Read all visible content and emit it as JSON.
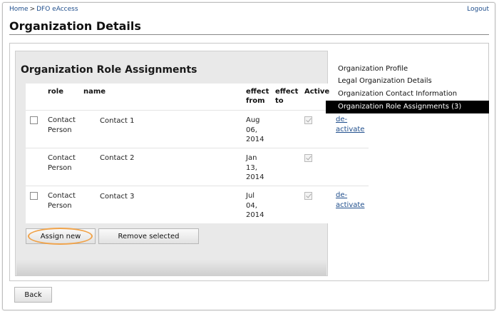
{
  "breadcrumb": {
    "home": "Home",
    "separator": ">",
    "current": "DFO eAccess"
  },
  "header": {
    "logout": "Logout",
    "title": "Organization Details"
  },
  "section": {
    "title": "Organization Role Assignments"
  },
  "table": {
    "columns": {
      "role": "role",
      "name": "name",
      "effect_from": "effect from",
      "effect_to": "effect to",
      "active": "Active"
    },
    "rows": [
      {
        "role_line1": "Contact",
        "role_line2": "Person",
        "name": "Contact 1",
        "from_line1": "Aug",
        "from_line2": "06,",
        "from_line3": "2014",
        "selectable": true,
        "active": true,
        "action_line1": "de-",
        "action_line2": "activate"
      },
      {
        "role_line1": "Contact",
        "role_line2": "Person",
        "name": "Contact 2",
        "from_line1": "Jan",
        "from_line2": "13,",
        "from_line3": "2014",
        "selectable": false,
        "active": true
      },
      {
        "role_line1": "Contact",
        "role_line2": "Person",
        "name": "Contact 3",
        "from_line1": "Jul",
        "from_line2": "04,",
        "from_line3": "2014",
        "selectable": true,
        "active": true,
        "action_line1": "de-",
        "action_line2": "activate"
      }
    ]
  },
  "buttons": {
    "assign_new": "Assign new",
    "remove_selected": "Remove selected",
    "back": "Back"
  },
  "sidenav": {
    "items": [
      {
        "label": "Organization Profile",
        "active": false
      },
      {
        "label": "Legal Organization Details",
        "active": false
      },
      {
        "label": "Organization Contact Information",
        "active": false
      },
      {
        "label": "Organization Role Assignments (3)",
        "active": true
      }
    ]
  },
  "colors": {
    "link": "#1f4e8c",
    "highlight": "#f0a34a",
    "active_nav_bg": "#000000"
  }
}
